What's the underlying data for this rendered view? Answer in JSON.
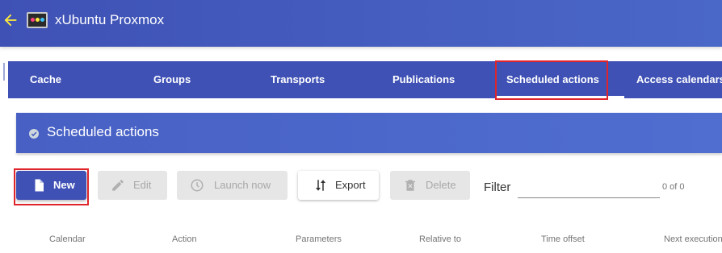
{
  "header": {
    "title": "xUbuntu Proxmox"
  },
  "tabs": [
    {
      "label": "Cache"
    },
    {
      "label": "Groups"
    },
    {
      "label": "Transports"
    },
    {
      "label": "Publications"
    },
    {
      "label": "Scheduled actions",
      "active": true
    },
    {
      "label": "Access calendars"
    }
  ],
  "section": {
    "title": "Scheduled actions"
  },
  "toolbar": {
    "new_label": "New",
    "edit_label": "Edit",
    "launch_label": "Launch now",
    "export_label": "Export",
    "delete_label": "Delete"
  },
  "filter": {
    "label": "Filter",
    "value": ""
  },
  "pagination": {
    "text": "0 of 0"
  },
  "table": {
    "columns": [
      "Calendar",
      "Action",
      "Parameters",
      "Relative to",
      "Time offset",
      "Next execution"
    ]
  },
  "colors": {
    "primary": "#3f51b5",
    "highlight": "#e0242b",
    "disabled": "#e6e6e6"
  }
}
